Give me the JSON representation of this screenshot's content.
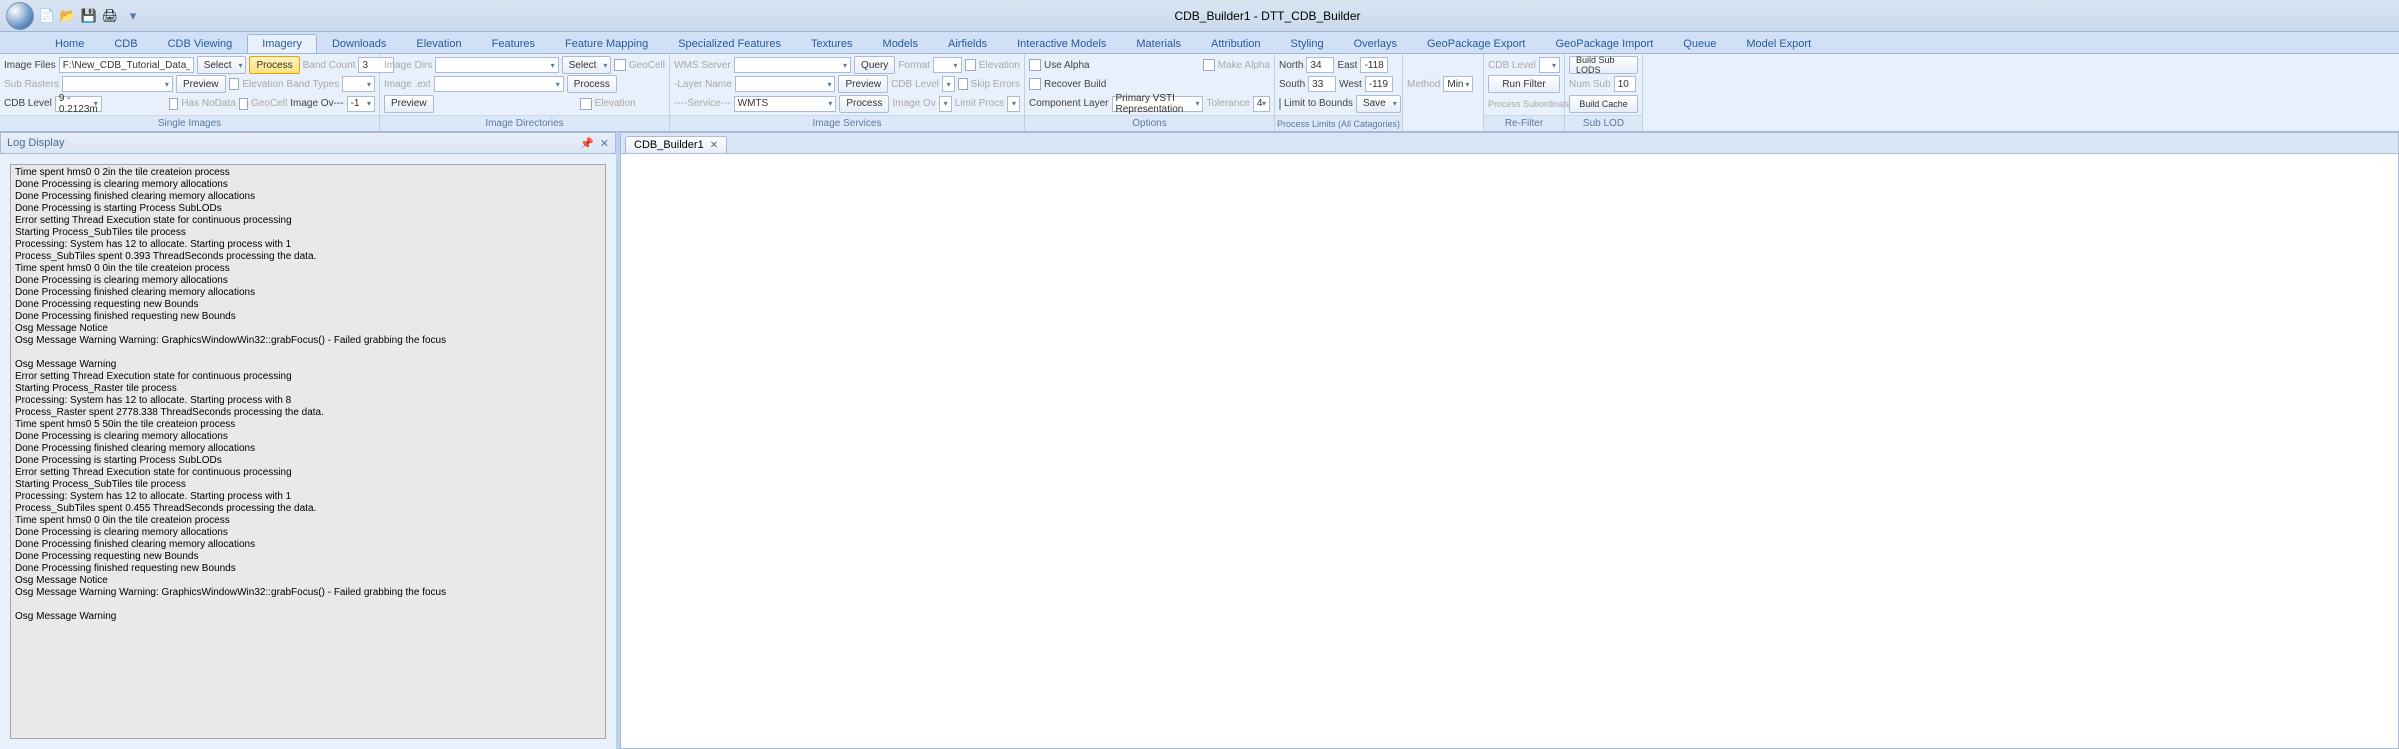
{
  "title": "CDB_Builder1 - DTT_CDB_Builder",
  "tabs": [
    "Home",
    "CDB",
    "CDB Viewing",
    "Imagery",
    "Downloads",
    "Elevation",
    "Features",
    "Feature Mapping",
    "Specialized Features",
    "Textures",
    "Models",
    "Airfields",
    "Interactive Models",
    "Materials",
    "Attribution",
    "Styling",
    "Overlays",
    "GeoPackage Export",
    "GeoPackage Import",
    "Queue",
    "Model Export"
  ],
  "active_tab": "Imagery",
  "g1": {
    "title": "Single Images",
    "image_files_lbl": "Image Files",
    "image_files_val": "F:\\New_CDB_Tutorial_Data_LongBeach",
    "select": "Select",
    "process": "Process",
    "band_count_lbl": "Band Count",
    "band_count_val": "3",
    "sub_rasters_lbl": "Sub Rasters",
    "preview": "Preview",
    "elevation_lbl": "Elevation",
    "band_types_lbl": "Band Types",
    "cdb_level_lbl": "CDB Level",
    "cdb_level_val": "9 - 0.2123m",
    "has_nodata_lbl": "Has NoData",
    "geocell_lbl": "GeoCell",
    "image_ov_lbl": "Image Ov---",
    "image_ov_val": "-1"
  },
  "g2": {
    "title": "Image Directories",
    "image_dirs_lbl": "Image Dirs",
    "select": "Select",
    "geocell_lbl": "GeoCell",
    "image_ext_lbl": "Image .ext",
    "process": "Process",
    "preview": "Preview",
    "elevation_lbl": "Elevation"
  },
  "g3": {
    "title": "Image Services",
    "wms_server_lbl": "WMS Server",
    "query": "Query",
    "format_lbl": "Format",
    "elevation_lbl": "Elevation",
    "layer_name_lbl": "-Layer Name",
    "preview": "Preview",
    "cdb_level_lbl": "CDB Level",
    "skip_errors_lbl": "Skip Errors",
    "service_lbl": "----Service---",
    "service_val": "WMTS",
    "process": "Process",
    "image_ov_lbl": "Image Ov",
    "limit_procs_lbl": "Limit Procs"
  },
  "g4": {
    "title": "Options",
    "use_alpha_lbl": "Use Alpha",
    "make_alpha_lbl": "Make Alpha",
    "recover_build_lbl": "Recover Build",
    "component_layer_lbl": "Component Layer",
    "component_layer_val": "Primary VSTI Representation",
    "tolerance_lbl": "Tolerance",
    "tolerance_val": "4"
  },
  "g5": {
    "title": "Process Limits (All Catagories)",
    "north_lbl": "North",
    "north_val": "34",
    "east_lbl": "East",
    "east_val": "-118",
    "south_lbl": "South",
    "south_val": "33",
    "west_lbl": "West",
    "west_val": "-119",
    "method_lbl": "Method",
    "method_val": "Min",
    "limit_bounds_lbl": "Limit to Bounds",
    "save": "Save"
  },
  "g6": {
    "title": "Re-Filter",
    "cdb_level_lbl": "CDB Level",
    "run_filter": "Run Filter",
    "process_sub_lbl": "Process Subordinate"
  },
  "g7": {
    "title": "Sub LOD",
    "build_sub_lods": "Build Sub LODS",
    "num_sub_lbl": "Num Sub",
    "num_sub_val": "10",
    "build_cache": "Build Cache"
  },
  "logdisplay_title": "Log Display",
  "doc_tab": "CDB_Builder1",
  "log_text": "Time spent hms0 0 2in the tile createion process\nDone Processing is clearing memory allocations\nDone Processing finished clearing memory allocations\nDone Processing is starting Process SubLODs\nError setting Thread Execution state for continuous processing\nStarting Process_SubTiles tile process\nProcessing: System has 12 to allocate. Starting process with 1\nProcess_SubTiles spent 0.393 ThreadSeconds processing the data.\nTime spent hms0 0 0in the tile createion process\nDone Processing is clearing memory allocations\nDone Processing finished clearing memory allocations\nDone Processing requesting new Bounds\nDone Processing finished requesting new Bounds\nOsg Message Notice \nOsg Message Warning Warning: GraphicsWindowWin32::grabFocus() - Failed grabbing the focus\n\nOsg Message Warning \nError setting Thread Execution state for continuous processing\nStarting Process_Raster tile process\nProcessing: System has 12 to allocate. Starting process with 8\nProcess_Raster spent 2778.338 ThreadSeconds processing the data.\nTime spent hms0 5 50in the tile createion process\nDone Processing is clearing memory allocations\nDone Processing finished clearing memory allocations\nDone Processing is starting Process SubLODs\nError setting Thread Execution state for continuous processing\nStarting Process_SubTiles tile process\nProcessing: System has 12 to allocate. Starting process with 1\nProcess_SubTiles spent 0.455 ThreadSeconds processing the data.\nTime spent hms0 0 0in the tile createion process\nDone Processing is clearing memory allocations\nDone Processing finished clearing memory allocations\nDone Processing requesting new Bounds\nDone Processing finished requesting new Bounds\nOsg Message Notice \nOsg Message Warning Warning: GraphicsWindowWin32::grabFocus() - Failed grabbing the focus\n\nOsg Message Warning "
}
